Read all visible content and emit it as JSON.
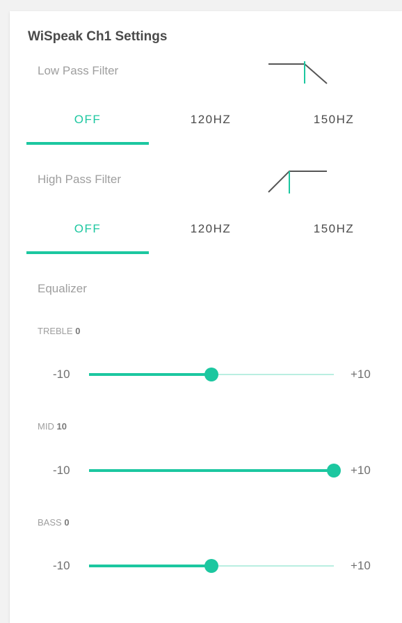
{
  "panel": {
    "title": "WiSpeak Ch1 Settings"
  },
  "low_pass": {
    "label": "Low Pass Filter",
    "icon": "low-pass-filter-icon",
    "options": [
      "OFF",
      "120HZ",
      "150HZ"
    ],
    "selected": "OFF"
  },
  "high_pass": {
    "label": "High Pass Filter",
    "icon": "high-pass-filter-icon",
    "options": [
      "OFF",
      "120HZ",
      "150HZ"
    ],
    "selected": "OFF"
  },
  "equalizer": {
    "label": "Equalizer",
    "min_label": "-10",
    "max_label": "+10",
    "range": [
      -10,
      10
    ],
    "bands": [
      {
        "name": "TREBLE",
        "value": 0
      },
      {
        "name": "MID",
        "value": 10
      },
      {
        "name": "BASS",
        "value": 0
      }
    ]
  },
  "colors": {
    "accent": "#1cc7a0",
    "track_inactive": "#b9eee1",
    "text": "#4a4a4a",
    "muted": "#9e9e9e"
  }
}
